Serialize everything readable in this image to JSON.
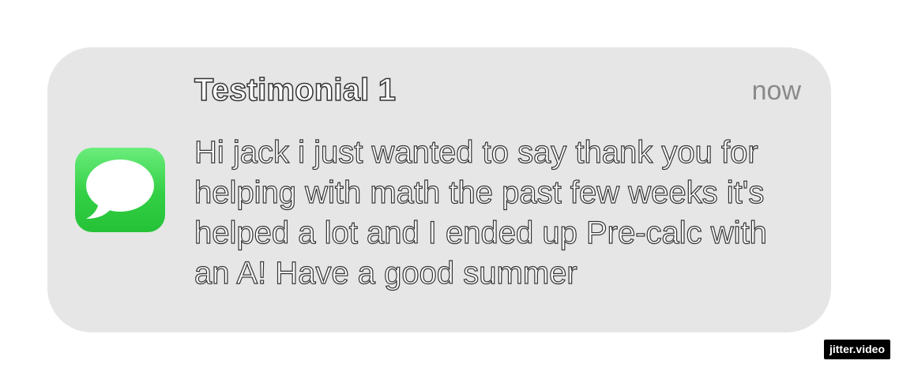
{
  "notification": {
    "app_icon": "messages-app-icon",
    "title": "Testimonial 1",
    "timestamp": "now",
    "message": "Hi jack i just wanted to say thank you for helping with math the past few weeks it's helped a lot and I ended up Pre-calc with an A! Have a good summer"
  },
  "watermark": {
    "label": "jitter.video"
  },
  "colors": {
    "card_background": "#e6e6e6",
    "icon_green": "#33cf45",
    "timestamp_gray": "#8a8a8a"
  }
}
